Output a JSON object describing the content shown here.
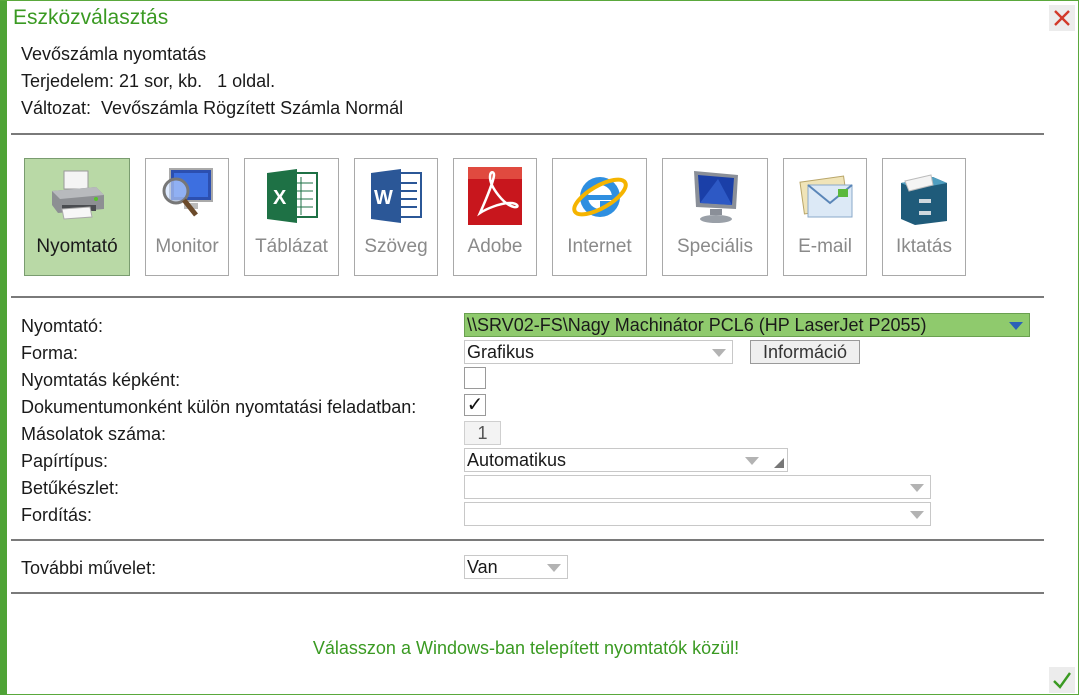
{
  "window": {
    "title": "Eszközválasztás"
  },
  "info": {
    "line1": "Vevőszámla nyomtatás",
    "line2": "Terjedelem: 21 sor, kb.   1 oldal.",
    "line3": "Változat:  Vevőszámla Rögzített Számla Normál"
  },
  "tools": [
    {
      "label": "Nyomtató",
      "icon": "printer-icon",
      "active": true
    },
    {
      "label": "Monitor",
      "icon": "monitor-search-icon"
    },
    {
      "label": "Táblázat",
      "icon": "excel-icon"
    },
    {
      "label": "Szöveg",
      "icon": "word-icon"
    },
    {
      "label": "Adobe",
      "icon": "adobe-icon"
    },
    {
      "label": "Internet",
      "icon": "internet-explorer-icon"
    },
    {
      "label": "Speciális",
      "icon": "special-monitor-icon"
    },
    {
      "label": "E-mail",
      "icon": "email-icon"
    },
    {
      "label": "Iktatás",
      "icon": "filing-cabinet-icon"
    }
  ],
  "form": {
    "printer_label": "Nyomtató:",
    "printer_value": "\\\\SRV02-FS\\Nagy Machinátor PCL6 (HP LaserJet P2055)",
    "forma_label": "Forma:",
    "forma_value": "Grafikus",
    "info_button": "Információ",
    "image_print_label": "Nyomtatás képként:",
    "image_print_checked": false,
    "per_doc_label": "Dokumentumonként külön nyomtatási feladatban:",
    "per_doc_checked": true,
    "per_doc_mark": "✓",
    "copies_label": "Másolatok száma:",
    "copies_value": "1",
    "paper_label": "Papírtípus:",
    "paper_value": "Automatikus",
    "charset_label": "Betűkészlet:",
    "charset_value": "",
    "rotation_label": "Fordítás:",
    "rotation_value": "",
    "further_label": "További művelet:",
    "further_value": "Van"
  },
  "footer": {
    "message": "Válasszon a Windows-ban telepített nyomtatók közül!",
    "ok_icon": "checkmark-icon",
    "close_icon": "close-icon"
  },
  "colors": {
    "accent": "#4fa336",
    "active_tool": "#b9d9a6",
    "printer_select": "#8fca6d"
  }
}
